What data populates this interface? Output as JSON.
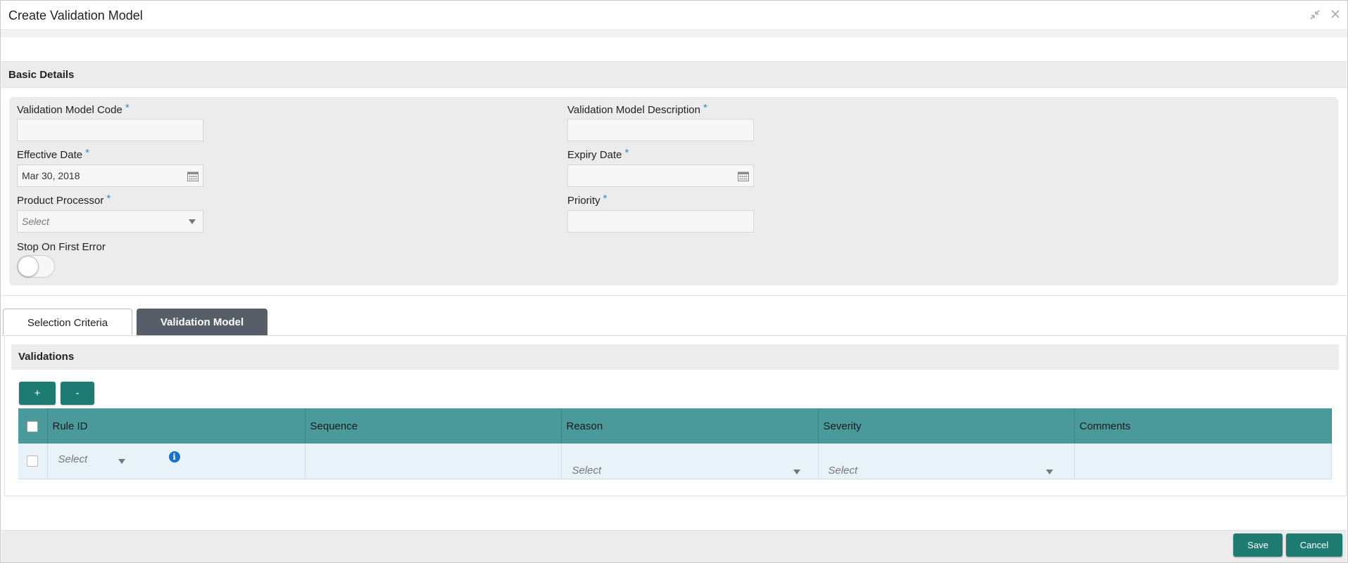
{
  "window": {
    "title": "Create Validation Model",
    "collapse_icon": "collapse-icon",
    "close_icon": "close-icon"
  },
  "basic_details": {
    "heading": "Basic Details",
    "validation_model_code": {
      "label": "Validation Model Code",
      "required": "*",
      "value": ""
    },
    "validation_model_description": {
      "label": "Validation Model Description",
      "required": "*",
      "value": ""
    },
    "effective_date": {
      "label": "Effective Date",
      "required": "*",
      "value": "Mar 30, 2018"
    },
    "expiry_date": {
      "label": "Expiry Date",
      "required": "*",
      "value": ""
    },
    "product_processor": {
      "label": "Product Processor",
      "required": "*",
      "value": "Select"
    },
    "priority": {
      "label": "Priority",
      "required": "*",
      "value": ""
    },
    "stop_on_first_error": {
      "label": "Stop On First Error",
      "enabled": false
    }
  },
  "tabs": [
    {
      "label": "Selection Criteria",
      "active": false
    },
    {
      "label": "Validation Model",
      "active": true
    }
  ],
  "validations": {
    "heading": "Validations",
    "add_label": "+",
    "remove_label": "-",
    "columns": [
      "Rule ID",
      "Sequence",
      "Reason",
      "Severity",
      "Comments"
    ],
    "rows": [
      {
        "rule_id": "Select",
        "sequence": "",
        "reason": "Select",
        "severity": "Select",
        "comments": ""
      }
    ]
  },
  "footer": {
    "save_label": "Save",
    "cancel_label": "Cancel"
  },
  "colors": {
    "accent": "#1e7b72",
    "grid_header": "#4a9a9c",
    "active_tab": "#585e67",
    "required_star": "#2b8fc4"
  }
}
